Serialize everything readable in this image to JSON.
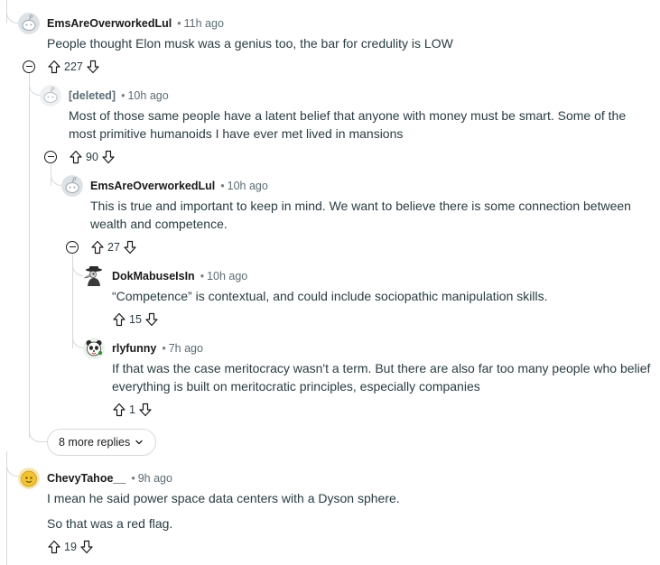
{
  "comments": [
    {
      "author": "EmsAreOverworkedLul",
      "time": "11h ago",
      "body": [
        "People thought Elon musk was a genius too, the bar for credulity is LOW"
      ],
      "votes": "227"
    },
    {
      "author": "[deleted]",
      "time": "10h ago",
      "body": [
        "Most of those same people have a latent belief that anyone with money must be smart. Some of the most primitive humanoids I have ever met lived in mansions"
      ],
      "votes": "90"
    },
    {
      "author": "EmsAreOverworkedLul",
      "time": "10h ago",
      "body": [
        "This is true and important to keep in mind. We want to believe there is some connection between wealth and competence."
      ],
      "votes": "27"
    },
    {
      "author": "DokMabuseIsIn",
      "time": "10h ago",
      "body": [
        "“Competence” is contextual, and could include sociopathic manipulation skills."
      ],
      "votes": "15"
    },
    {
      "author": "rlyfunny",
      "time": "7h ago",
      "body": [
        "If that was the case meritocracy wasn't a term. But there are also far too many people who belief everything is built on meritocratic principles, especially companies"
      ],
      "votes": "1"
    },
    {
      "author": "ChevyTahoe__",
      "time": "9h ago",
      "body": [
        "I mean he said power space data centers with a Dyson sphere.",
        "So that was a red flag."
      ],
      "votes": "19"
    }
  ],
  "more_replies": {
    "label": "8 more replies"
  },
  "separator": "•",
  "icons": {
    "upvote": "arrow-up-outline-icon",
    "downvote": "arrow-down-outline-icon",
    "collapse": "minus-circle-icon",
    "expand": "chevron-down-icon"
  },
  "colors": {
    "thread_line": "#d6d9dc",
    "text": "#1a1a1b",
    "muted": "#5c6c74"
  }
}
